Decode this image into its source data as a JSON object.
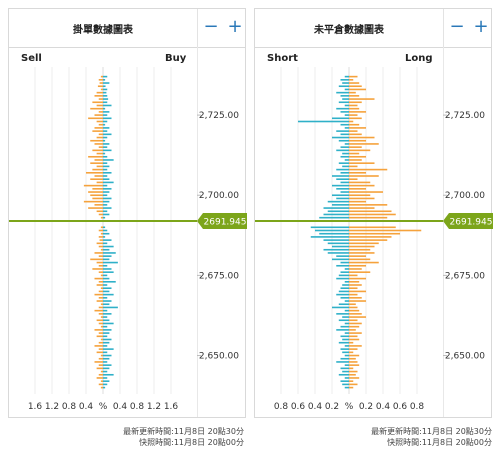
{
  "left_panel": {
    "title": "掛單數據圖表",
    "left_label": "Sell",
    "right_label": "Buy",
    "zoom_out": "−",
    "zoom_in": "+",
    "footer_line1": "最新更新時間:11月8日 20點30分",
    "footer_line2": "快照時間:11月8日 20點00分"
  },
  "right_panel": {
    "title": "未平倉數據圖表",
    "left_label": "Short",
    "right_label": "Long",
    "zoom_out": "−",
    "zoom_in": "+",
    "footer_line1": "最新更新時間:11月8日 20點30分",
    "footer_line2": "快照時間:11月8日 20點00分"
  },
  "colors": {
    "orange": "#f5a23c",
    "blue": "#2fb0c8",
    "price_line": "#7ca51a",
    "grid": "#ececec",
    "text": "#333333"
  },
  "chart_data": [
    {
      "type": "bar",
      "title": "掛單數據圖表",
      "orientation": "horizontal",
      "price_axis": {
        "min": 2638,
        "max": 2740,
        "ticks": [
          "2,725.00",
          "2,700.00",
          "2,675.00",
          "2,650.00"
        ],
        "tick_values": [
          2725,
          2700,
          2675,
          2650
        ]
      },
      "percent_axis": {
        "ticks_left": [
          "1.6",
          "1.2",
          "0.8",
          "0.4"
        ],
        "center": "%",
        "ticks_right": [
          "0.4",
          "0.8",
          "1.2",
          "1.6"
        ],
        "max": 2.0
      },
      "current_price": {
        "value": 2691.945,
        "label": "2691.945"
      },
      "series": [
        {
          "name": "Sell",
          "color": "#f5a23c"
        },
        {
          "name": "Buy",
          "color": "#2fb0c8"
        }
      ],
      "bars": [
        [
          2737,
          0.05,
          0.1
        ],
        [
          2736,
          0.1,
          0.05
        ],
        [
          2735,
          0.08,
          0.15
        ],
        [
          2734,
          0.12,
          0.06
        ],
        [
          2733,
          0.05,
          0.1
        ],
        [
          2732,
          0.15,
          0.08
        ],
        [
          2731,
          0.2,
          0.1
        ],
        [
          2730,
          0.1,
          0.12
        ],
        [
          2729,
          0.25,
          0.1
        ],
        [
          2728,
          0.15,
          0.2
        ],
        [
          2727,
          0.3,
          0.05
        ],
        [
          2726,
          0.1,
          0.15
        ],
        [
          2725,
          0.2,
          0.1
        ],
        [
          2724,
          0.35,
          0.2
        ],
        [
          2723,
          0.15,
          0.1
        ],
        [
          2722,
          0.1,
          0.05
        ],
        [
          2721,
          0.2,
          0.15
        ],
        [
          2720,
          0.25,
          0.1
        ],
        [
          2719,
          0.1,
          0.2
        ],
        [
          2718,
          0.15,
          0.1
        ],
        [
          2717,
          0.3,
          0.05
        ],
        [
          2716,
          0.2,
          0.15
        ],
        [
          2715,
          0.1,
          0.1
        ],
        [
          2714,
          0.25,
          0.2
        ],
        [
          2713,
          0.15,
          0.05
        ],
        [
          2712,
          0.35,
          0.1
        ],
        [
          2711,
          0.2,
          0.25
        ],
        [
          2710,
          0.3,
          0.1
        ],
        [
          2709,
          0.15,
          0.15
        ],
        [
          2708,
          0.25,
          0.1
        ],
        [
          2707,
          0.4,
          0.2
        ],
        [
          2706,
          0.2,
          0.1
        ],
        [
          2705,
          0.3,
          0.15
        ],
        [
          2704,
          0.15,
          0.25
        ],
        [
          2703,
          0.45,
          0.1
        ],
        [
          2702,
          0.25,
          0.2
        ],
        [
          2701,
          0.35,
          0.15
        ],
        [
          2700,
          0.3,
          0.1
        ],
        [
          2699,
          0.25,
          0.2
        ],
        [
          2698,
          0.45,
          0.15
        ],
        [
          2697,
          0.2,
          0.1
        ],
        [
          2696,
          0.35,
          0.2
        ],
        [
          2695,
          0.15,
          0.1
        ],
        [
          2694,
          0.1,
          0.15
        ],
        [
          2693,
          0.05,
          0.05
        ],
        [
          2690,
          0.05,
          0.05
        ],
        [
          2689,
          0.1,
          0.1
        ],
        [
          2688,
          0.05,
          0.15
        ],
        [
          2687,
          0.1,
          0.05
        ],
        [
          2686,
          0.08,
          0.2
        ],
        [
          2685,
          0.15,
          0.1
        ],
        [
          2684,
          0.1,
          0.25
        ],
        [
          2683,
          0.05,
          0.15
        ],
        [
          2682,
          0.2,
          0.3
        ],
        [
          2681,
          0.1,
          0.2
        ],
        [
          2680,
          0.3,
          0.15
        ],
        [
          2679,
          0.15,
          0.35
        ],
        [
          2678,
          0.1,
          0.1
        ],
        [
          2677,
          0.25,
          0.2
        ],
        [
          2676,
          0.1,
          0.25
        ],
        [
          2675,
          0.05,
          0.1
        ],
        [
          2674,
          0.2,
          0.15
        ],
        [
          2673,
          0.1,
          0.3
        ],
        [
          2672,
          0.15,
          0.1
        ],
        [
          2671,
          0.05,
          0.2
        ],
        [
          2670,
          0.1,
          0.15
        ],
        [
          2669,
          0.2,
          0.25
        ],
        [
          2668,
          0.1,
          0.1
        ],
        [
          2667,
          0.15,
          0.2
        ],
        [
          2666,
          0.05,
          0.15
        ],
        [
          2665,
          0.1,
          0.35
        ],
        [
          2664,
          0.2,
          0.1
        ],
        [
          2663,
          0.1,
          0.2
        ],
        [
          2662,
          0.05,
          0.1
        ],
        [
          2661,
          0.15,
          0.15
        ],
        [
          2660,
          0.1,
          0.25
        ],
        [
          2659,
          0.05,
          0.1
        ],
        [
          2658,
          0.2,
          0.2
        ],
        [
          2657,
          0.1,
          0.15
        ],
        [
          2656,
          0.15,
          0.1
        ],
        [
          2655,
          0.05,
          0.2
        ],
        [
          2654,
          0.1,
          0.15
        ],
        [
          2653,
          0.2,
          0.1
        ],
        [
          2652,
          0.1,
          0.25
        ],
        [
          2651,
          0.15,
          0.1
        ],
        [
          2650,
          0.05,
          0.2
        ],
        [
          2649,
          0.1,
          0.15
        ],
        [
          2648,
          0.2,
          0.1
        ],
        [
          2647,
          0.1,
          0.2
        ],
        [
          2646,
          0.15,
          0.15
        ],
        [
          2645,
          0.05,
          0.1
        ],
        [
          2644,
          0.1,
          0.25
        ],
        [
          2643,
          0.15,
          0.1
        ],
        [
          2642,
          0.05,
          0.15
        ],
        [
          2641,
          0.1,
          0.1
        ],
        [
          2640,
          0.05,
          0.05
        ]
      ]
    },
    {
      "type": "bar",
      "title": "未平倉數據圖表",
      "orientation": "horizontal",
      "price_axis": {
        "min": 2638,
        "max": 2740,
        "ticks": [
          "2,725.00",
          "2,700.00",
          "2,675.00",
          "2,650.00"
        ],
        "tick_values": [
          2725,
          2700,
          2675,
          2650
        ]
      },
      "percent_axis": {
        "ticks_left": [
          "0.8",
          "0.6",
          "0.4",
          "0.2"
        ],
        "center": "%",
        "ticks_right": [
          "0.2",
          "0.4",
          "0.6",
          "0.8"
        ],
        "max": 1.0
      },
      "current_price": {
        "value": 2691.945,
        "label": "2691.945"
      },
      "series": [
        {
          "name": "Short",
          "color": "#2fb0c8"
        },
        {
          "name": "Long",
          "color": "#f5a23c"
        }
      ],
      "bars": [
        [
          2737,
          0.05,
          0.1
        ],
        [
          2736,
          0.1,
          0.05
        ],
        [
          2735,
          0.08,
          0.12
        ],
        [
          2734,
          0.12,
          0.15
        ],
        [
          2733,
          0.05,
          0.2
        ],
        [
          2732,
          0.15,
          0.08
        ],
        [
          2731,
          0.1,
          0.12
        ],
        [
          2730,
          0.08,
          0.3
        ],
        [
          2729,
          0.12,
          0.15
        ],
        [
          2728,
          0.05,
          0.1
        ],
        [
          2727,
          0.15,
          0.12
        ],
        [
          2726,
          0.1,
          0.2
        ],
        [
          2725,
          0.05,
          0.1
        ],
        [
          2724,
          0.2,
          0.15
        ],
        [
          2723,
          0.6,
          0.05
        ],
        [
          2722,
          0.1,
          0.12
        ],
        [
          2721,
          0.05,
          0.2
        ],
        [
          2720,
          0.15,
          0.1
        ],
        [
          2719,
          0.1,
          0.15
        ],
        [
          2718,
          0.2,
          0.3
        ],
        [
          2717,
          0.12,
          0.2
        ],
        [
          2716,
          0.05,
          0.35
        ],
        [
          2715,
          0.1,
          0.15
        ],
        [
          2714,
          0.15,
          0.25
        ],
        [
          2713,
          0.08,
          0.12
        ],
        [
          2712,
          0.1,
          0.2
        ],
        [
          2711,
          0.05,
          0.15
        ],
        [
          2710,
          0.12,
          0.3
        ],
        [
          2709,
          0.08,
          0.1
        ],
        [
          2708,
          0.15,
          0.45
        ],
        [
          2707,
          0.1,
          0.2
        ],
        [
          2706,
          0.2,
          0.35
        ],
        [
          2705,
          0.15,
          0.1
        ],
        [
          2704,
          0.1,
          0.25
        ],
        [
          2703,
          0.2,
          0.3
        ],
        [
          2702,
          0.15,
          0.2
        ],
        [
          2701,
          0.1,
          0.4
        ],
        [
          2700,
          0.2,
          0.25
        ],
        [
          2699,
          0.15,
          0.3
        ],
        [
          2698,
          0.25,
          0.2
        ],
        [
          2697,
          0.2,
          0.45
        ],
        [
          2696,
          0.3,
          0.3
        ],
        [
          2695,
          0.25,
          0.5
        ],
        [
          2694,
          0.3,
          0.55
        ],
        [
          2693,
          0.35,
          0.45
        ],
        [
          2690,
          0.45,
          0.55
        ],
        [
          2689,
          0.4,
          0.85
        ],
        [
          2688,
          0.35,
          0.6
        ],
        [
          2687,
          0.45,
          0.5
        ],
        [
          2686,
          0.3,
          0.45
        ],
        [
          2685,
          0.25,
          0.35
        ],
        [
          2684,
          0.2,
          0.3
        ],
        [
          2683,
          0.3,
          0.25
        ],
        [
          2682,
          0.25,
          0.3
        ],
        [
          2681,
          0.15,
          0.2
        ],
        [
          2680,
          0.2,
          0.25
        ],
        [
          2679,
          0.1,
          0.35
        ],
        [
          2678,
          0.15,
          0.2
        ],
        [
          2677,
          0.05,
          0.15
        ],
        [
          2676,
          0.1,
          0.25
        ],
        [
          2675,
          0.12,
          0.1
        ],
        [
          2674,
          0.15,
          0.2
        ],
        [
          2673,
          0.05,
          0.12
        ],
        [
          2672,
          0.08,
          0.15
        ],
        [
          2671,
          0.1,
          0.1
        ],
        [
          2670,
          0.12,
          0.2
        ],
        [
          2669,
          0.15,
          0.1
        ],
        [
          2668,
          0.1,
          0.15
        ],
        [
          2667,
          0.05,
          0.2
        ],
        [
          2666,
          0.12,
          0.08
        ],
        [
          2665,
          0.2,
          0.1
        ],
        [
          2664,
          0.05,
          0.12
        ],
        [
          2663,
          0.15,
          0.15
        ],
        [
          2662,
          0.08,
          0.2
        ],
        [
          2661,
          0.12,
          0.1
        ],
        [
          2660,
          0.05,
          0.15
        ],
        [
          2659,
          0.1,
          0.12
        ],
        [
          2658,
          0.15,
          0.08
        ],
        [
          2657,
          0.05,
          0.15
        ],
        [
          2656,
          0.1,
          0.1
        ],
        [
          2655,
          0.08,
          0.12
        ],
        [
          2654,
          0.12,
          0.05
        ],
        [
          2653,
          0.05,
          0.15
        ],
        [
          2652,
          0.1,
          0.1
        ],
        [
          2651,
          0.08,
          0.05
        ],
        [
          2650,
          0.05,
          0.12
        ],
        [
          2649,
          0.1,
          0.08
        ],
        [
          2648,
          0.15,
          0.1
        ],
        [
          2647,
          0.05,
          0.12
        ],
        [
          2646,
          0.1,
          0.05
        ],
        [
          2645,
          0.08,
          0.1
        ],
        [
          2644,
          0.12,
          0.08
        ],
        [
          2643,
          0.05,
          0.12
        ],
        [
          2642,
          0.1,
          0.05
        ],
        [
          2641,
          0.08,
          0.1
        ],
        [
          2640,
          0.05,
          0.05
        ]
      ]
    }
  ]
}
